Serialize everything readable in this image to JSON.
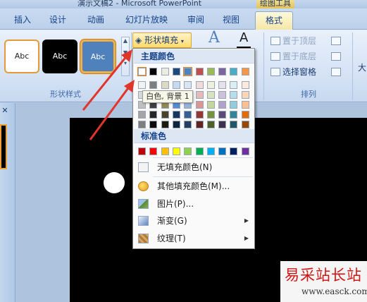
{
  "window": {
    "title_partial": "演示文稿2 - Microsoft PowerPoint",
    "context_tools": "绘图工具"
  },
  "tabs": [
    {
      "label": "插入"
    },
    {
      "label": "设计"
    },
    {
      "label": "动画"
    },
    {
      "label": "幻灯片放映"
    },
    {
      "label": "审阅"
    },
    {
      "label": "视图"
    },
    {
      "label": "格式"
    }
  ],
  "ribbon": {
    "shape_styles": {
      "group_label": "形状样式",
      "style_samples": [
        "Abc",
        "Abc",
        "Abc"
      ]
    },
    "fill_button": "形状填充",
    "arrange": {
      "group_label": "排列",
      "bring_to_front": "置于顶层",
      "send_to_back": "置于底层",
      "selection_pane": "选择窗格"
    },
    "size_partial": "大"
  },
  "dropdown": {
    "theme_colors_header": "主题颜色",
    "standard_colors_header": "标准色",
    "theme_row": [
      "#ffffff",
      "#000000",
      "#eeece1",
      "#1f497d",
      "#4f81bd",
      "#c0504d",
      "#9bbb59",
      "#8064a2",
      "#4bacc6",
      "#f79646"
    ],
    "theme_shades": [
      [
        "#f2f2f2",
        "#7f7f7f",
        "#ddd9c3",
        "#c6d9f0",
        "#dbe5f1",
        "#f2dcdb",
        "#ebf1dd",
        "#e5e0ec",
        "#dbeef3",
        "#fdeada"
      ],
      [
        "#d8d8d8",
        "#595959",
        "#c4bd97",
        "#8db3e2",
        "#b8cce4",
        "#e5b9b7",
        "#d7e3bc",
        "#ccc1d9",
        "#b7dde8",
        "#fbd5b5"
      ],
      [
        "#bfbfbf",
        "#3f3f3f",
        "#938953",
        "#548dd4",
        "#95b3d7",
        "#d99694",
        "#c3d69b",
        "#b2a2c7",
        "#92cddc",
        "#fac08f"
      ],
      [
        "#a5a5a5",
        "#262626",
        "#494429",
        "#17365d",
        "#366092",
        "#953734",
        "#76923c",
        "#5f497a",
        "#31859b",
        "#e36c09"
      ],
      [
        "#7f7f7f",
        "#0c0c0c",
        "#1d1b10",
        "#0f243e",
        "#244061",
        "#632423",
        "#4f6128",
        "#3f3151",
        "#205867",
        "#974806"
      ]
    ],
    "standard_row": [
      "#c00000",
      "#ff0000",
      "#ffc000",
      "#ffff00",
      "#92d050",
      "#00b050",
      "#00b0f0",
      "#0070c0",
      "#002060",
      "#7030a0"
    ],
    "tooltip": "白色, 背景 1",
    "items": [
      {
        "label": "无填充颜色(N)",
        "icon": "no-fill-icon"
      },
      {
        "label": "其他填充颜色(M)...",
        "icon": "palette-icon"
      },
      {
        "label": "图片(P)...",
        "icon": "picture-icon"
      },
      {
        "label": "渐变(G)",
        "icon": "gradient-icon"
      },
      {
        "label": "纹理(T)",
        "icon": "texture-icon"
      }
    ]
  },
  "watermark": {
    "line1": "易采站长站",
    "line2": "www.easck.com"
  },
  "colors": {
    "accent_highlight": "#ffd96c",
    "arrow_red": "#e0352b"
  }
}
